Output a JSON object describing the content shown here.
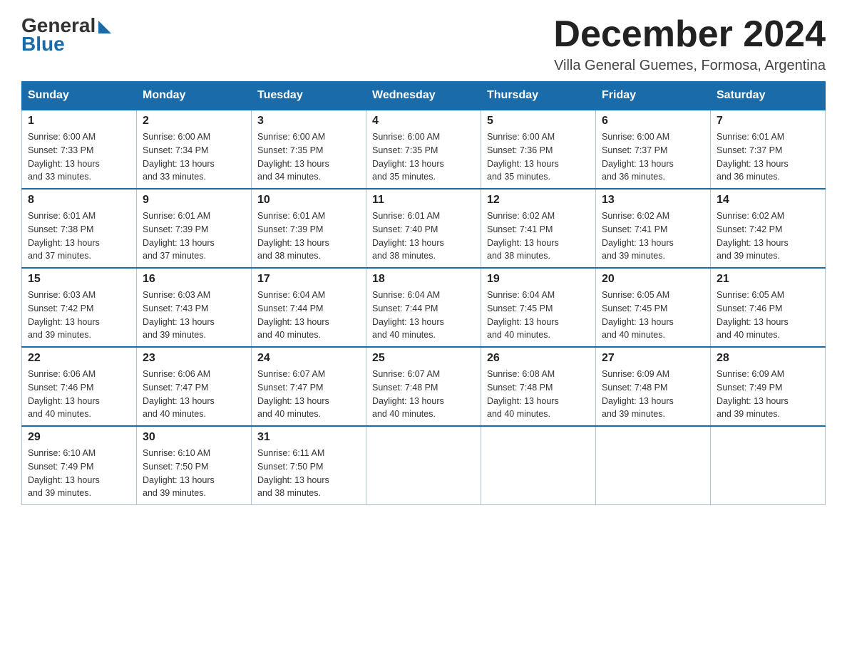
{
  "logo": {
    "general": "General",
    "blue": "Blue"
  },
  "title": "December 2024",
  "location": "Villa General Guemes, Formosa, Argentina",
  "headers": [
    "Sunday",
    "Monday",
    "Tuesday",
    "Wednesday",
    "Thursday",
    "Friday",
    "Saturday"
  ],
  "weeks": [
    [
      {
        "day": "1",
        "sunrise": "6:00 AM",
        "sunset": "7:33 PM",
        "daylight": "13 hours and 33 minutes."
      },
      {
        "day": "2",
        "sunrise": "6:00 AM",
        "sunset": "7:34 PM",
        "daylight": "13 hours and 33 minutes."
      },
      {
        "day": "3",
        "sunrise": "6:00 AM",
        "sunset": "7:35 PM",
        "daylight": "13 hours and 34 minutes."
      },
      {
        "day": "4",
        "sunrise": "6:00 AM",
        "sunset": "7:35 PM",
        "daylight": "13 hours and 35 minutes."
      },
      {
        "day": "5",
        "sunrise": "6:00 AM",
        "sunset": "7:36 PM",
        "daylight": "13 hours and 35 minutes."
      },
      {
        "day": "6",
        "sunrise": "6:00 AM",
        "sunset": "7:37 PM",
        "daylight": "13 hours and 36 minutes."
      },
      {
        "day": "7",
        "sunrise": "6:01 AM",
        "sunset": "7:37 PM",
        "daylight": "13 hours and 36 minutes."
      }
    ],
    [
      {
        "day": "8",
        "sunrise": "6:01 AM",
        "sunset": "7:38 PM",
        "daylight": "13 hours and 37 minutes."
      },
      {
        "day": "9",
        "sunrise": "6:01 AM",
        "sunset": "7:39 PM",
        "daylight": "13 hours and 37 minutes."
      },
      {
        "day": "10",
        "sunrise": "6:01 AM",
        "sunset": "7:39 PM",
        "daylight": "13 hours and 38 minutes."
      },
      {
        "day": "11",
        "sunrise": "6:01 AM",
        "sunset": "7:40 PM",
        "daylight": "13 hours and 38 minutes."
      },
      {
        "day": "12",
        "sunrise": "6:02 AM",
        "sunset": "7:41 PM",
        "daylight": "13 hours and 38 minutes."
      },
      {
        "day": "13",
        "sunrise": "6:02 AM",
        "sunset": "7:41 PM",
        "daylight": "13 hours and 39 minutes."
      },
      {
        "day": "14",
        "sunrise": "6:02 AM",
        "sunset": "7:42 PM",
        "daylight": "13 hours and 39 minutes."
      }
    ],
    [
      {
        "day": "15",
        "sunrise": "6:03 AM",
        "sunset": "7:42 PM",
        "daylight": "13 hours and 39 minutes."
      },
      {
        "day": "16",
        "sunrise": "6:03 AM",
        "sunset": "7:43 PM",
        "daylight": "13 hours and 39 minutes."
      },
      {
        "day": "17",
        "sunrise": "6:04 AM",
        "sunset": "7:44 PM",
        "daylight": "13 hours and 40 minutes."
      },
      {
        "day": "18",
        "sunrise": "6:04 AM",
        "sunset": "7:44 PM",
        "daylight": "13 hours and 40 minutes."
      },
      {
        "day": "19",
        "sunrise": "6:04 AM",
        "sunset": "7:45 PM",
        "daylight": "13 hours and 40 minutes."
      },
      {
        "day": "20",
        "sunrise": "6:05 AM",
        "sunset": "7:45 PM",
        "daylight": "13 hours and 40 minutes."
      },
      {
        "day": "21",
        "sunrise": "6:05 AM",
        "sunset": "7:46 PM",
        "daylight": "13 hours and 40 minutes."
      }
    ],
    [
      {
        "day": "22",
        "sunrise": "6:06 AM",
        "sunset": "7:46 PM",
        "daylight": "13 hours and 40 minutes."
      },
      {
        "day": "23",
        "sunrise": "6:06 AM",
        "sunset": "7:47 PM",
        "daylight": "13 hours and 40 minutes."
      },
      {
        "day": "24",
        "sunrise": "6:07 AM",
        "sunset": "7:47 PM",
        "daylight": "13 hours and 40 minutes."
      },
      {
        "day": "25",
        "sunrise": "6:07 AM",
        "sunset": "7:48 PM",
        "daylight": "13 hours and 40 minutes."
      },
      {
        "day": "26",
        "sunrise": "6:08 AM",
        "sunset": "7:48 PM",
        "daylight": "13 hours and 40 minutes."
      },
      {
        "day": "27",
        "sunrise": "6:09 AM",
        "sunset": "7:48 PM",
        "daylight": "13 hours and 39 minutes."
      },
      {
        "day": "28",
        "sunrise": "6:09 AM",
        "sunset": "7:49 PM",
        "daylight": "13 hours and 39 minutes."
      }
    ],
    [
      {
        "day": "29",
        "sunrise": "6:10 AM",
        "sunset": "7:49 PM",
        "daylight": "13 hours and 39 minutes."
      },
      {
        "day": "30",
        "sunrise": "6:10 AM",
        "sunset": "7:50 PM",
        "daylight": "13 hours and 39 minutes."
      },
      {
        "day": "31",
        "sunrise": "6:11 AM",
        "sunset": "7:50 PM",
        "daylight": "13 hours and 38 minutes."
      },
      null,
      null,
      null,
      null
    ]
  ],
  "labels": {
    "sunrise": "Sunrise:",
    "sunset": "Sunset:",
    "daylight": "Daylight:"
  },
  "colors": {
    "header_bg": "#1a6baa",
    "border": "#b0c4d8",
    "top_border": "#1a6baa"
  }
}
